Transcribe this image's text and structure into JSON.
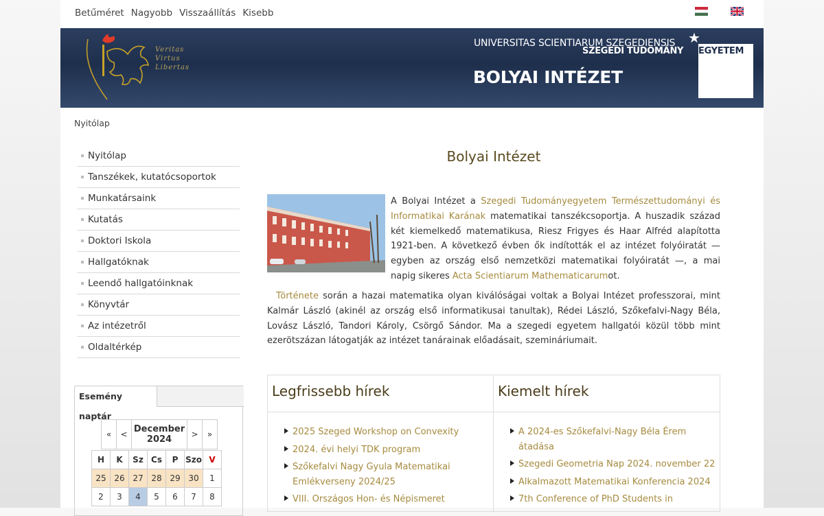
{
  "fontsize": {
    "label": "Betűméret",
    "bigger": "Nagyobb",
    "reset": "Visszaállítás",
    "smaller": "Kisebb"
  },
  "languages": [
    "hungarian-flag-icon",
    "english-flag-icon"
  ],
  "header": {
    "motto": [
      "Veritas",
      "Virtus",
      "Libertas"
    ],
    "university_latin": "UNIVERSITAS SCIENTIARUM SZEGEDIENSIS",
    "university_hu_part1": "SZEGEDI TUDOMÁNY",
    "university_hu_part2": "EGYETEM",
    "institute": "BOLYAI INTÉZET"
  },
  "breadcrumb": "Nyitólap",
  "sidebar": {
    "items": [
      {
        "label": "Nyitólap"
      },
      {
        "label": "Tanszékek, kutatócsoportok"
      },
      {
        "label": "Munkatársaink"
      },
      {
        "label": "Kutatás"
      },
      {
        "label": "Doktori Iskola"
      },
      {
        "label": "Hallgatóknak"
      },
      {
        "label": "Leendő hallgatóinknak"
      },
      {
        "label": "Könyvtár"
      },
      {
        "label": "Az intézetről"
      },
      {
        "label": "Oldaltérkép"
      }
    ]
  },
  "calendar": {
    "tab": "Esemény naptár",
    "nav": {
      "first": "«",
      "prev": "<",
      "next": ">",
      "last": "»"
    },
    "month": "December",
    "year": "2024",
    "weekdays": [
      "H",
      "K",
      "Sz",
      "Cs",
      "P",
      "Szo",
      "V"
    ],
    "week1": [
      "25",
      "26",
      "27",
      "28",
      "29",
      "30",
      "1"
    ],
    "week2": [
      "2",
      "3",
      "4",
      "5",
      "6",
      "7",
      "8"
    ]
  },
  "main": {
    "title": "Bolyai Intézet",
    "p1": {
      "t1": "A Bolyai Intézet a ",
      "link1": "Szegedi Tudományegyetem Természettudományi és Informatikai Karának",
      "t2": " matematikai tanszékcsoportja. A huszadik század két kiemelkedő matematikusa, Riesz Frigyes és Haar Alfréd alapította 1921-ben. A következő évben ők indították el az intézet folyóiratát — egyben az ország első nemzetközi matematikai folyóiratát —, a mai napig sikeres ",
      "link2": "Acta Scientiarum Mathematicarum",
      "t3": "ot."
    },
    "p2": {
      "link": "Története",
      "text": " során a hazai matematika olyan kiválóságai voltak a Bolyai Intézet professzorai, mint Kalmár László (akinél az ország első informatikusai tanultak), Rédei László, Szőkefalvi-Nagy Béla, Lovász László, Tandori Károly, Csörgő Sándor. Ma a szegedi egyetem hallgatói közül több mint ezerötszázan látogatják az intézet tanárainak előadásait, szemináriumait."
    }
  },
  "news": {
    "latest": {
      "title": "Legfrissebb hírek",
      "items": [
        "2025 Szeged Workshop on Convexity",
        "2024. évi helyi TDK program",
        "Szőkefalvi Nagy Gyula Matematikai Emlékverseny 2024/25",
        "VIII. Országos Hon- és Népismeret"
      ]
    },
    "featured": {
      "title": "Kiemelt hírek",
      "items": [
        "A 2024-es Szőkefalvi-Nagy Béla Érem átadása",
        "Szegedi Geometria Nap 2024. november 22",
        "Alkalmazott Matematikai Konferencia 2024",
        "7th Conference of PhD Students in"
      ]
    }
  }
}
